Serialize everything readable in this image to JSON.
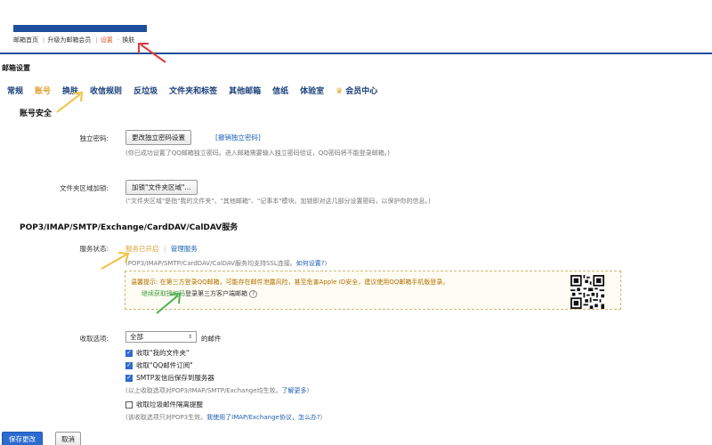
{
  "topnav": {
    "items": [
      "邮箱首页",
      "升级为邮箱会员",
      "设置",
      "换肤"
    ],
    "active_index": 2
  },
  "page_title": "邮箱设置",
  "tabs": {
    "items": [
      "常规",
      "账号",
      "换肤",
      "收信规则",
      "反垃圾",
      "文件夹和标签",
      "其他邮箱",
      "信纸",
      "体验室",
      "会员中心"
    ],
    "active_index": 1
  },
  "account_security": {
    "title": "账号安全",
    "independent_password": {
      "label": "独立密码:",
      "button": "更改独立密码设置",
      "link": "[撤销独立密码]",
      "hint": "(你已成功设置了QQ邮箱独立密码。进入邮箱需要输入独立密码验证，QQ密码将不能登录邮箱。)"
    },
    "folder_encrypt": {
      "label": "文件夹区域加锁:",
      "button": "加锁\"文件夹区域\"...",
      "hint": "(\"文件夹区域\"是指\"我的文件夹\"、\"其他邮箱\"、\"记事本\"模块。加锁即对这几部分设置密码，以保护你的信息。)"
    }
  },
  "pop3": {
    "title": "POP3/IMAP/SMTP/Exchange/CardDAV/CalDAV服务",
    "service_status": {
      "label": "服务状态:",
      "status_link": "服务已开启",
      "manage_link": "管理服务",
      "hint_prefix": "(POP3/IMAP/SMTP/CardDAV/CalDAV服务均支持SSL连接。",
      "hint_link": "如何设置?",
      "hint_suffix": ")"
    },
    "notice": {
      "line1": "温馨提示: 在第三方登录QQ邮箱，可能存在邮件泄露风险，甚至危害Apple ID安全，建议使用QQ邮箱手机版登录。",
      "link": "继续获取授权码",
      "line2_suffix": "登录第三方客户端邮箱",
      "help_icon": "?"
    },
    "receive": {
      "label": "收取选项:",
      "select_value": "全部",
      "select_suffix": "的邮件",
      "options": [
        {
          "label": "收取\"我的文件夹\"",
          "checked": true
        },
        {
          "label": "收取\"QQ邮件订阅\"",
          "checked": true
        },
        {
          "label": "SMTP发信后保存到服务器",
          "checked": true
        }
      ],
      "hint1_prefix": "(以上收取选项对POP3/IMAP/SMTP/Exchange均生效。",
      "hint1_link": "了解更多",
      "hint1_suffix": ")",
      "junk_option": {
        "label": "收取垃圾邮件隔离提醒",
        "checked": false
      },
      "hint2_prefix": "(该收取选项只对POP3生效。",
      "hint2_link": "我使用了IMAP/Exchange协议，怎么办?",
      "hint2_suffix": ")"
    }
  },
  "footer": {
    "save": "保存更改",
    "cancel": "取消"
  },
  "colors": {
    "brand": "#1f4e9c",
    "active_tab": "#e0a030",
    "primary_button": "#2d6bd1",
    "annotation_red": "#e03a3a",
    "annotation_yellow": "#f0c040",
    "annotation_green": "#4caf50"
  }
}
